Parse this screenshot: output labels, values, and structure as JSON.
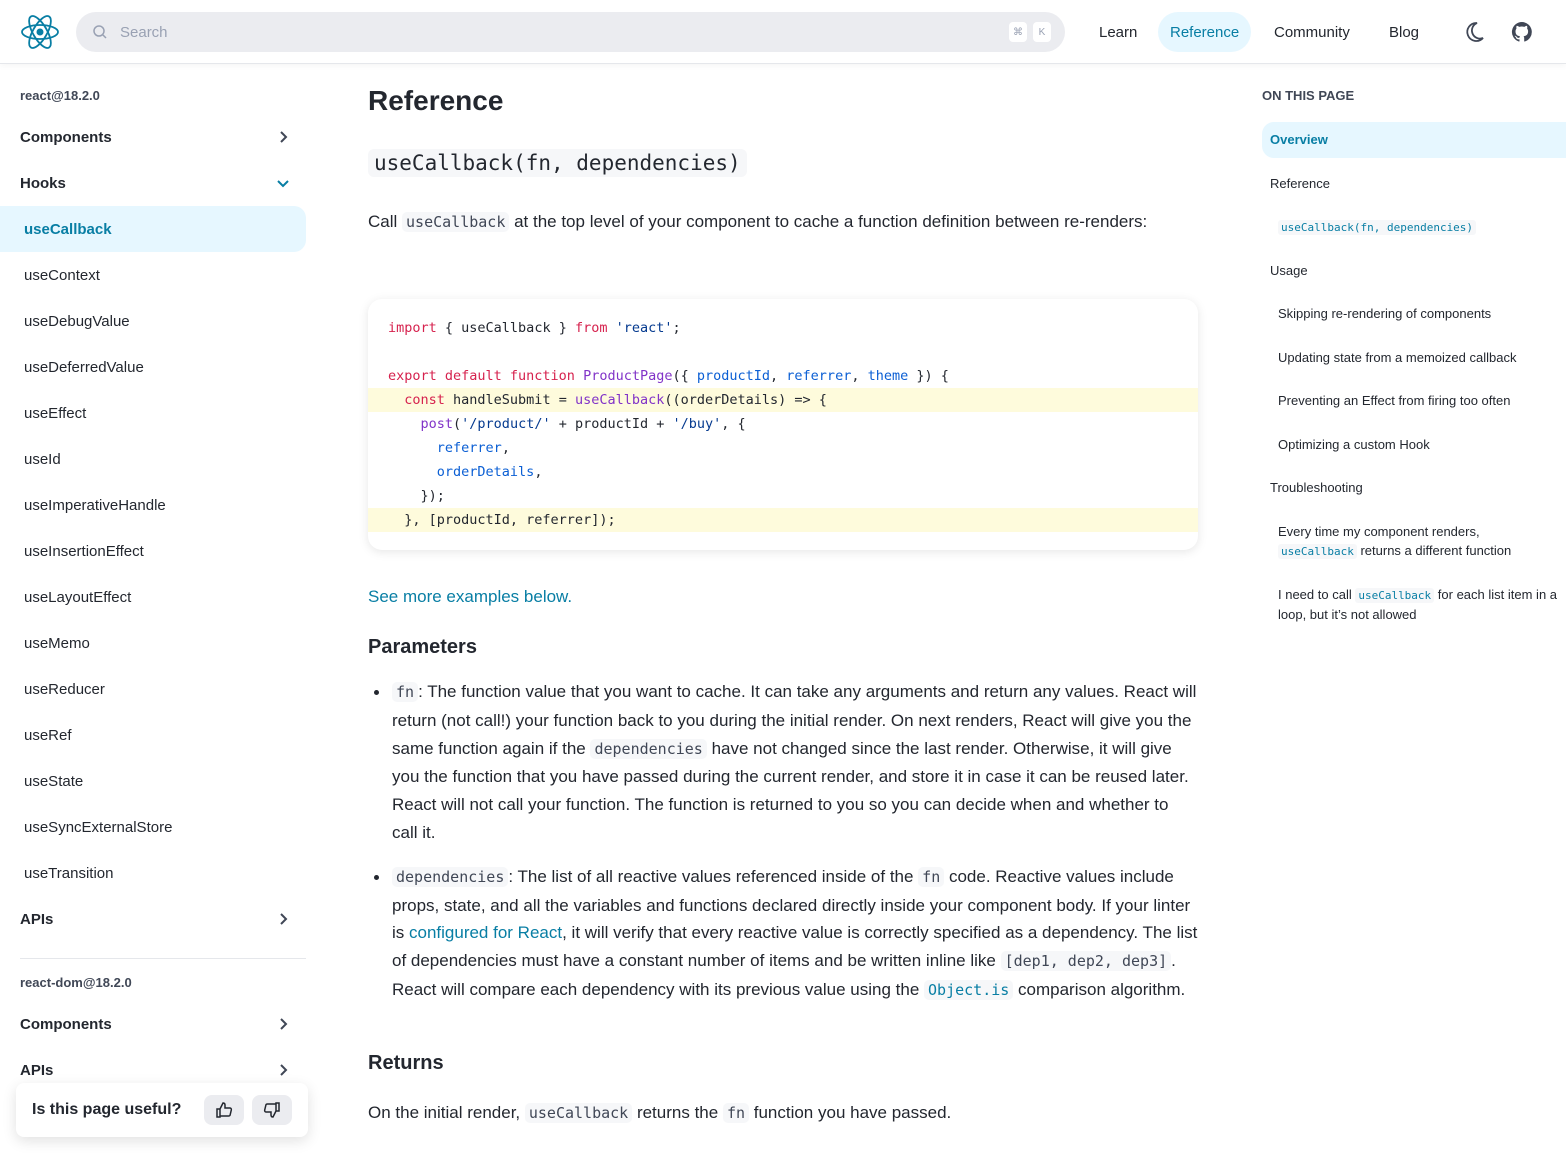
{
  "header": {
    "search_placeholder": "Search",
    "kbd": [
      "⌘",
      "K"
    ],
    "nav": [
      "Learn",
      "Reference",
      "Community",
      "Blog"
    ],
    "active_nav": "Reference"
  },
  "sidebar": {
    "react_label": "react@18.2.0",
    "components": "Components",
    "hooks": "Hooks",
    "hooks_items": [
      "useCallback",
      "useContext",
      "useDebugValue",
      "useDeferredValue",
      "useEffect",
      "useId",
      "useImperativeHandle",
      "useInsertionEffect",
      "useLayoutEffect",
      "useMemo",
      "useReducer",
      "useRef",
      "useState",
      "useSyncExternalStore",
      "useTransition"
    ],
    "apis": "APIs",
    "react_dom_label": "react-dom@18.2.0",
    "dom_components": "Components",
    "dom_apis": "APIs"
  },
  "feedback": {
    "question": "Is this page useful?"
  },
  "main": {
    "title": "Reference",
    "signature": "useCallback(fn, dependencies)",
    "intro": {
      "a": "Call ",
      "code": "useCallback",
      "b": " at the top level of your component to cache a function definition between re-renders:"
    },
    "code_lines": [
      {
        "hl": false,
        "t": [
          [
            "k",
            "import"
          ],
          [
            "p",
            " { useCallback } "
          ],
          [
            "k",
            "from"
          ],
          [
            "p",
            " "
          ],
          [
            "s",
            "'react'"
          ],
          [
            "p",
            ";"
          ]
        ]
      },
      {
        "hl": false,
        "t": []
      },
      {
        "hl": false,
        "t": [
          [
            "k",
            "export default function "
          ],
          [
            "f",
            "ProductPage"
          ],
          [
            "p",
            "({ "
          ],
          [
            "v",
            "productId"
          ],
          [
            "p",
            ", "
          ],
          [
            "v",
            "referrer"
          ],
          [
            "p",
            ", "
          ],
          [
            "v",
            "theme"
          ],
          [
            "p",
            " }) {"
          ]
        ]
      },
      {
        "hl": true,
        "t": [
          [
            "p",
            "  "
          ],
          [
            "k",
            "const"
          ],
          [
            "p",
            " handleSubmit = "
          ],
          [
            "f",
            "useCallback"
          ],
          [
            "p",
            "((orderDetails) => {"
          ]
        ]
      },
      {
        "hl": false,
        "t": [
          [
            "p",
            "    "
          ],
          [
            "f",
            "post"
          ],
          [
            "p",
            "("
          ],
          [
            "s",
            "'/product/'"
          ],
          [
            "p",
            " + productId + "
          ],
          [
            "s",
            "'/buy'"
          ],
          [
            "p",
            ", {"
          ]
        ]
      },
      {
        "hl": false,
        "t": [
          [
            "p",
            "      "
          ],
          [
            "v",
            "referrer"
          ],
          [
            "p",
            ","
          ]
        ]
      },
      {
        "hl": false,
        "t": [
          [
            "p",
            "      "
          ],
          [
            "v",
            "orderDetails"
          ],
          [
            "p",
            ","
          ]
        ]
      },
      {
        "hl": false,
        "t": [
          [
            "p",
            "    });"
          ]
        ]
      },
      {
        "hl": true,
        "t": [
          [
            "p",
            "  }, [productId, referrer]);"
          ]
        ]
      }
    ],
    "see_more": "See more examples below.",
    "parameters_heading": "Parameters",
    "param_fn": {
      "code": "fn",
      "a": ": The function value that you want to cache. It can take any arguments and return any values. React will return (not call!) your function back to you during the initial render. On next renders, React will give you the same function again if the ",
      "code2": "dependencies",
      "b": " have not changed since the last render. Otherwise, it will give you the function that you have passed during the current render, and store it in case it can be reused later. React will not call your function. The function is returned to you so you can decide when and whether to call it."
    },
    "param_deps": {
      "code": "dependencies",
      "a": ": The list of all reactive values referenced inside of the ",
      "code2": "fn",
      "b": " code. Reactive values include props, state, and all the variables and functions declared directly inside your component body. If your linter is ",
      "link": "configured for React",
      "c": ", it will verify that every reactive value is correctly specified as a dependency. The list of dependencies must have a constant number of items and be written inline like ",
      "code3": "[dep1, dep2, dep3]",
      "d": ". React will compare each dependency with its previous value using the ",
      "code4": "Object.is",
      "e": " comparison algorithm."
    },
    "returns_heading": "Returns",
    "returns": {
      "a": "On the initial render, ",
      "code": "useCallback",
      "b": " returns the ",
      "code2": "fn",
      "c": " function you have passed."
    }
  },
  "toc": {
    "heading": "ON THIS PAGE",
    "overview": "Overview",
    "reference": "Reference",
    "signature": "useCallback(fn, dependencies)",
    "usage": "Usage",
    "usage_items": [
      "Skipping re-rendering of components",
      "Updating state from a memoized callback",
      "Preventing an Effect from firing too often",
      "Optimizing a custom Hook"
    ],
    "troubleshooting": "Troubleshooting",
    "t1": {
      "a": "Every time my component renders, ",
      "code": "useCallback",
      "b": " returns a different function"
    },
    "t2": {
      "a": "I need to call ",
      "code": "useCallback",
      "b": " for each list item in a loop, but it’s not allowed"
    }
  }
}
